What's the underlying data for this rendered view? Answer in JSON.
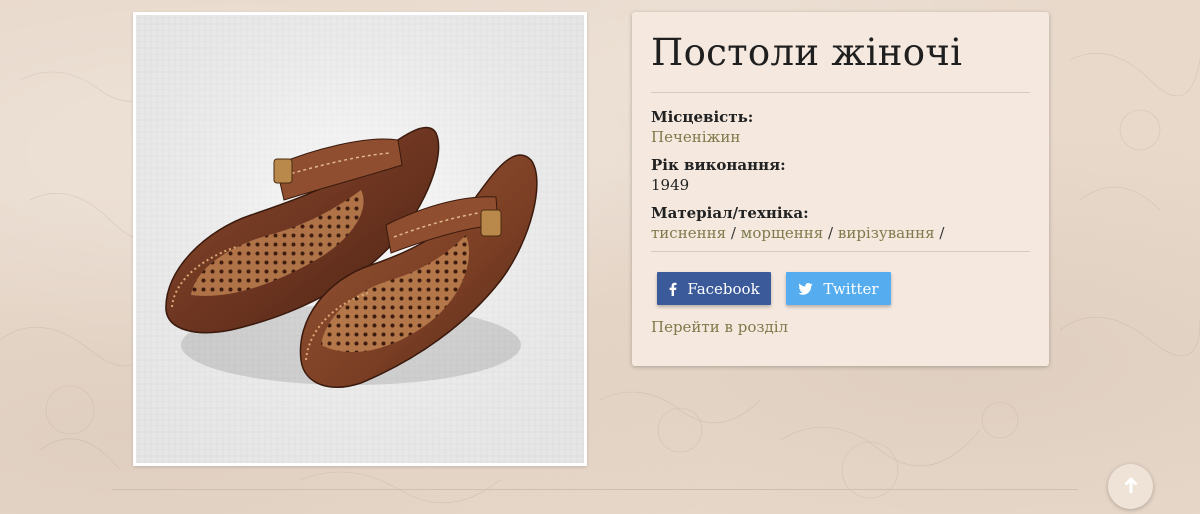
{
  "item": {
    "title": "Постоли жіночі",
    "image_alt": "women-leather-shoes-photo"
  },
  "fields": {
    "location": {
      "label": "Місцевість:",
      "value": "Печеніжин"
    },
    "year": {
      "label": "Рік виконання:",
      "value": "1949"
    },
    "technique": {
      "label": "Матеріал/техніка:",
      "values": [
        "тиснення",
        "морщення",
        "вирізування"
      ],
      "separator": "/"
    }
  },
  "share": {
    "facebook_label": "Facebook",
    "twitter_label": "Twitter"
  },
  "section_link": "Перейти в розділ",
  "colors": {
    "page_bg": "#e8d9cb",
    "card_bg": "#f4e8df",
    "link": "#7e7a4a",
    "facebook": "#3a5a99",
    "twitter": "#55acee"
  },
  "icons": {
    "facebook": "facebook-f-icon",
    "twitter": "twitter-bird-icon",
    "scroll_top": "arrow-up-icon"
  }
}
